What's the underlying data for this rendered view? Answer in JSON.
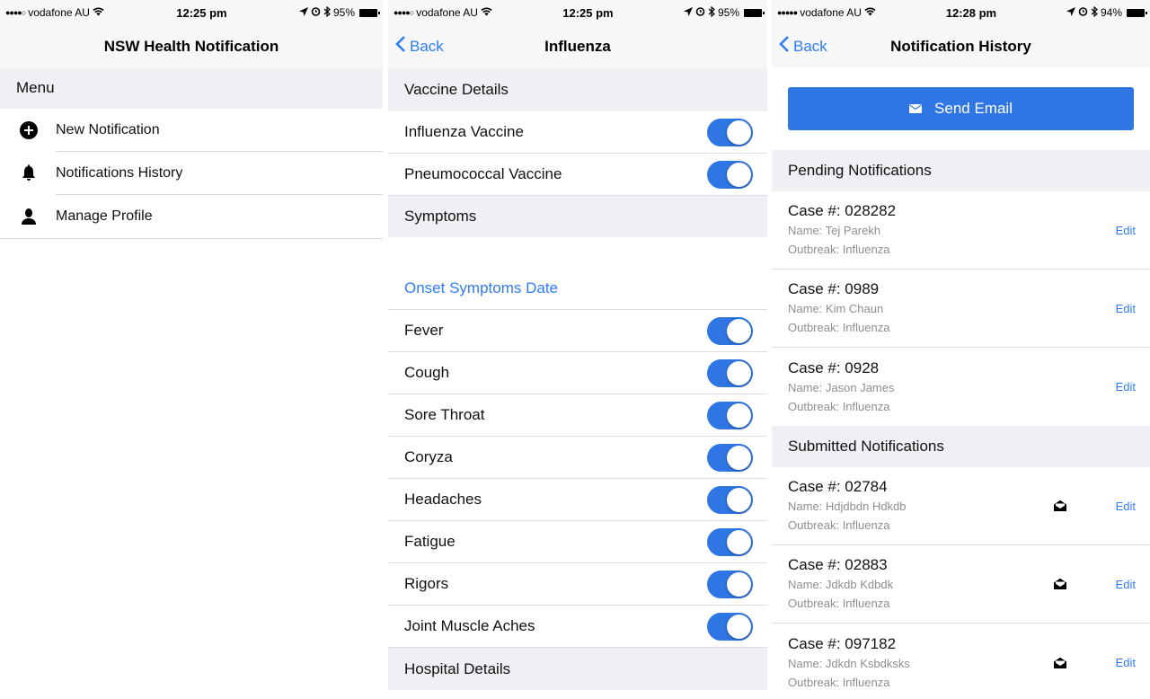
{
  "status_bars": [
    {
      "signal": "●●●●○",
      "carrier": "vodafone AU",
      "time": "12:25 pm",
      "battery": "95%"
    },
    {
      "signal": "●●●●○",
      "carrier": "vodafone AU",
      "time": "12:25 pm",
      "battery": "95%"
    },
    {
      "signal": "●●●●●",
      "carrier": "vodafone AU",
      "time": "12:28 pm",
      "battery": "94%"
    }
  ],
  "screen1": {
    "title": "NSW Health Notification",
    "section": "Menu",
    "items": [
      {
        "label": "New Notification",
        "icon": "plus-circle-icon"
      },
      {
        "label": "Notifications History",
        "icon": "bell-icon"
      },
      {
        "label": "Manage Profile",
        "icon": "person-icon"
      }
    ]
  },
  "screen2": {
    "back": "Back",
    "title": "Influenza",
    "vaccine_section": "Vaccine Details",
    "vaccines": [
      {
        "label": "Influenza Vaccine",
        "on": true
      },
      {
        "label": "Pneumococcal Vaccine",
        "on": true
      }
    ],
    "symptoms_section": "Symptoms",
    "onset_date": "Onset Symptoms Date",
    "symptoms": [
      {
        "label": "Fever",
        "on": true
      },
      {
        "label": "Cough",
        "on": true
      },
      {
        "label": "Sore Throat",
        "on": true
      },
      {
        "label": "Coryza",
        "on": true
      },
      {
        "label": "Headaches",
        "on": true
      },
      {
        "label": "Fatigue",
        "on": true
      },
      {
        "label": "Rigors",
        "on": true
      },
      {
        "label": "Joint Muscle Aches",
        "on": true
      }
    ],
    "hospital_section": "Hospital Details"
  },
  "screen3": {
    "back": "Back",
    "title": "Notification History",
    "send_email": "Send Email",
    "pending_section": "Pending Notifications",
    "pending": [
      {
        "case": "Case #: 028282",
        "name": "Name: Tej Parekh",
        "outbreak": "Outbreak: Influenza",
        "edit": "Edit"
      },
      {
        "case": "Case #: 0989",
        "name": "Name: Kim Chaun",
        "outbreak": "Outbreak: Influenza",
        "edit": "Edit"
      },
      {
        "case": "Case #: 0928",
        "name": "Name: Jason James",
        "outbreak": "Outbreak: Influenza",
        "edit": "Edit"
      }
    ],
    "submitted_section": "Submitted Notifications",
    "submitted": [
      {
        "case": "Case #: 02784",
        "name": "Name: Hdjdbdn Hdkdb",
        "outbreak": "Outbreak: Influenza",
        "edit": "Edit"
      },
      {
        "case": "Case #: 02883",
        "name": "Name: Jdkdb Kdbdk",
        "outbreak": "Outbreak: Influenza",
        "edit": "Edit"
      },
      {
        "case": "Case #: 097182",
        "name": "Name: Jdkdn Ksbdksks",
        "outbreak": "Outbreak: Influenza",
        "edit": "Edit"
      }
    ]
  },
  "colors": {
    "accent": "#2f76e4",
    "link": "#2f7df6",
    "section_bg": "#efeff4",
    "subtext": "#8e8e93"
  }
}
